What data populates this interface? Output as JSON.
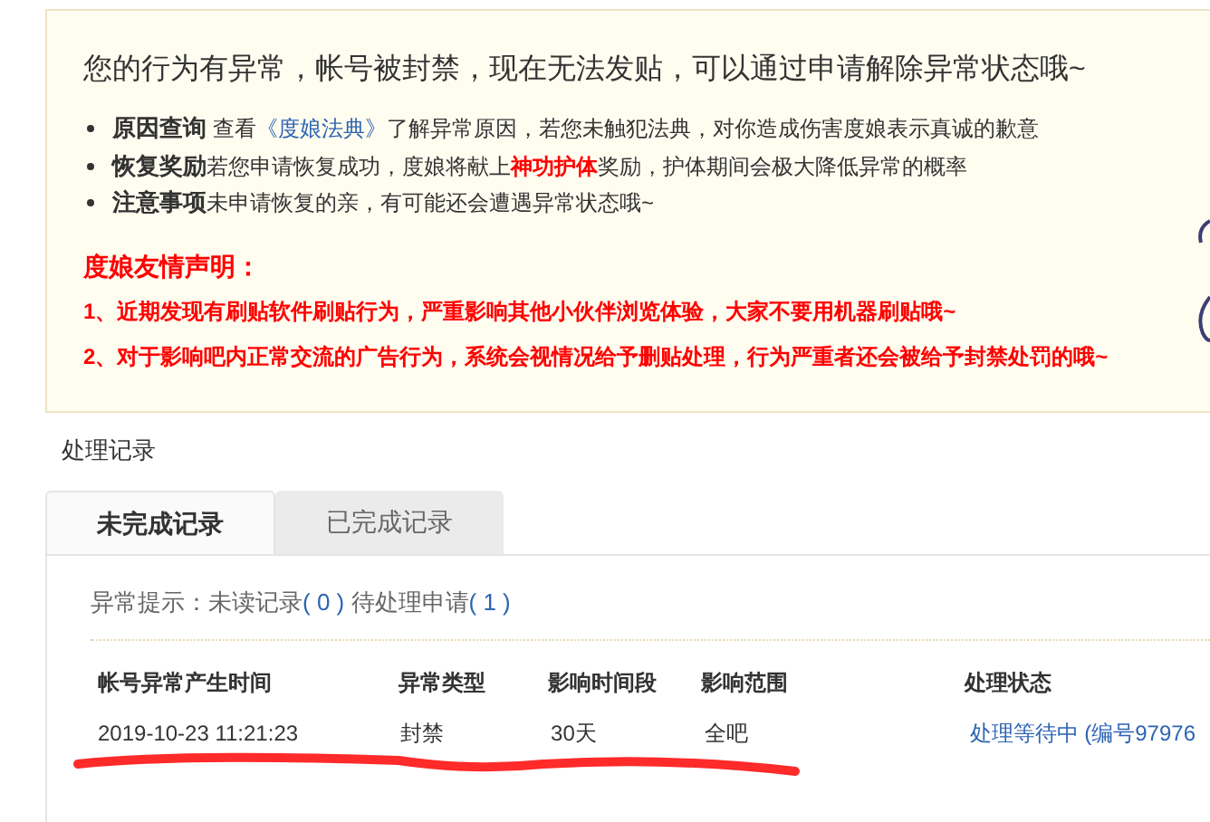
{
  "notice": {
    "title": "您的行为有异常，帐号被封禁，现在无法发贴，可以通过申请解除异常状态哦~",
    "items": [
      {
        "label": "原因查询",
        "segments": [
          {
            "kind": "text",
            "text": " 查看"
          },
          {
            "kind": "link",
            "text": "《度娘法典》"
          },
          {
            "kind": "text",
            "text": "了解异常原因，若您未触犯法典，对你造成伤害度娘表示真诚的歉意"
          }
        ]
      },
      {
        "label": "恢复奖励",
        "segments": [
          {
            "kind": "text",
            "text": "若您申请恢复成功，度娘将献上"
          },
          {
            "kind": "highlight",
            "text": "神功护体"
          },
          {
            "kind": "text",
            "text": "奖励，护体期间会极大降低异常的概率"
          }
        ]
      },
      {
        "label": "注意事项",
        "segments": [
          {
            "kind": "text",
            "text": "未申请恢复的亲，有可能还会遭遇异常状态哦~"
          }
        ]
      }
    ],
    "declaration": {
      "title": "度娘友情声明：",
      "lines": [
        "1、近期发现有刷贴软件刷贴行为，严重影响其他小伙伴浏览体验，大家不要用机器刷贴哦~",
        "2、对于影响吧内正常交流的广告行为，系统会视情况给予删贴处理，行为严重者还会被给予封禁处罚的哦~"
      ]
    }
  },
  "records": {
    "title": "处理记录",
    "tabs": [
      {
        "label": "未完成记录",
        "selected": true
      },
      {
        "label": "已完成记录",
        "selected": false
      }
    ],
    "alert": {
      "label": "异常提示：",
      "unread_label": "未读记录",
      "unread_count": "( 0 )",
      "pending_label": "待处理申请",
      "pending_count": "( 1 )"
    },
    "columns": [
      "帐号异常产生时间",
      "异常类型",
      "影响时间段",
      "影响范围",
      "处理状态"
    ],
    "rows": [
      {
        "time": "2019-10-23 11:21:23",
        "type": "封禁",
        "duration": "30天",
        "scope": "全吧",
        "status": "处理等待中 (编号97976"
      }
    ]
  }
}
